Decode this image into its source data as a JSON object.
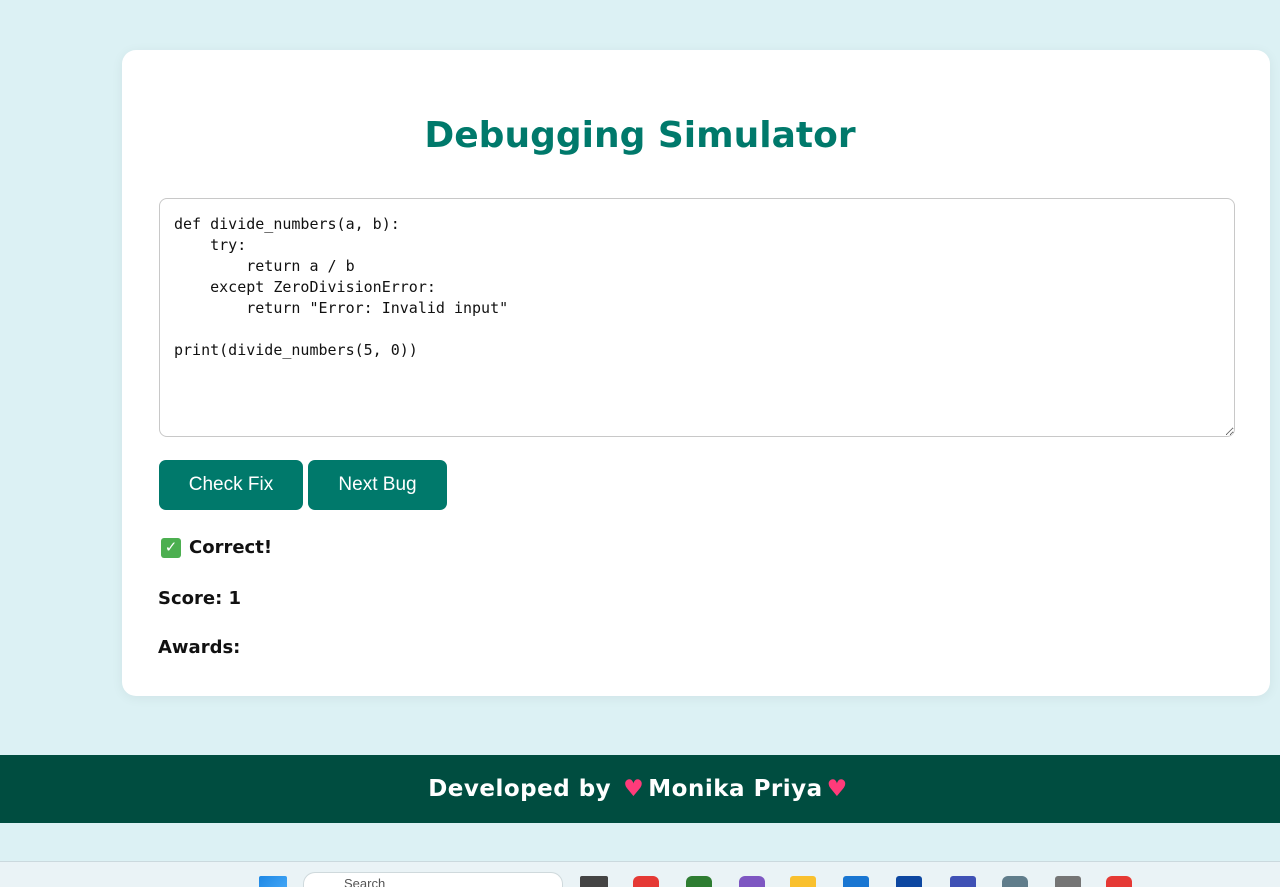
{
  "app": {
    "title": "Debugging Simulator"
  },
  "editor": {
    "code": "def divide_numbers(a, b):\n    try:\n        return a / b\n    except ZeroDivisionError:\n        return \"Error: Invalid input\"\n\nprint(divide_numbers(5, 0))"
  },
  "buttons": {
    "check_fix": "Check Fix",
    "next_bug": "Next Bug"
  },
  "result": {
    "text": "Correct!"
  },
  "score": {
    "text": "Score: 1"
  },
  "awards": {
    "label": "Awards:"
  },
  "footer": {
    "prefix": "Developed by",
    "name": "Monika Priya",
    "heart": "♥"
  },
  "taskbar": {
    "search_placeholder": "Search",
    "icons": [
      "windows-start-icon",
      "search-icon",
      "task-view-icon",
      "chrome-icon",
      "whatsapp-icon",
      "copilot-icon",
      "file-explorer-icon",
      "vscode-icon",
      "store-icon",
      "terminal-icon",
      "settings-icon",
      "camera-icon",
      "chrome-profile-icon"
    ]
  },
  "colors": {
    "accent": "#00796b",
    "footer_bg": "#004d40",
    "page_bg": "#dcf1f4",
    "success": "#4caf50",
    "heart": "#ff3b7a"
  }
}
